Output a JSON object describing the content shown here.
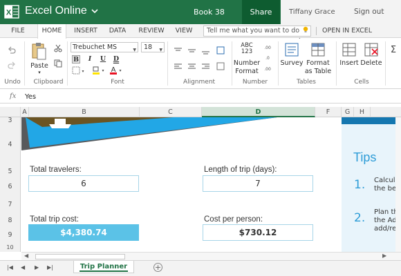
{
  "app": {
    "name": "Excel Online",
    "book_title": "Book 38",
    "share_label": "Share",
    "user_name": "Tiffany Grace Reyes",
    "signout_label": "Sign out"
  },
  "tabs": [
    {
      "label": "FILE"
    },
    {
      "label": "HOME"
    },
    {
      "label": "INSERT"
    },
    {
      "label": "DATA"
    },
    {
      "label": "REVIEW"
    },
    {
      "label": "VIEW"
    }
  ],
  "tellme": {
    "placeholder": "Tell me what you want to do"
  },
  "open_in_excel": "OPEN IN EXCEL",
  "ribbon": {
    "undo_group": "Undo",
    "clipboard_group": "Clipboard",
    "font_group": "Font",
    "alignment_group": "Alignment",
    "number_group": "Number",
    "tables_group": "Tables",
    "cells_group": "Cells",
    "paste_label": "Paste",
    "font_name": "Trebuchet MS",
    "font_size": "18",
    "bold": "B",
    "italic": "I",
    "underline": "U",
    "double_underline": "D",
    "number_format_line1": "Number",
    "number_format_line2": "Format",
    "number_format_icon": "ABC 123",
    "survey_label": "Survey",
    "format_table_line1": "Format",
    "format_table_line2": "as Table",
    "insert_label": "Insert",
    "delete_label": "Delete"
  },
  "formula_bar": {
    "fx": "fx",
    "value": "Yes"
  },
  "columns": [
    "A",
    "B",
    "C",
    "D",
    "F",
    "G",
    "H"
  ],
  "selected_column": "D",
  "rows": [
    "3",
    "4",
    "5",
    "6",
    "7",
    "8",
    "9",
    "10"
  ],
  "sheet": {
    "total_travelers_label": "Total travelers:",
    "total_travelers_value": "6",
    "length_of_trip_label": "Length of trip (days):",
    "length_of_trip_value": "7",
    "total_trip_cost_label": "Total trip cost:",
    "total_trip_cost_value": "$4,380.74",
    "cost_per_person_label": "Cost per person:",
    "cost_per_person_value": "$730.12"
  },
  "tips": {
    "title": "Tips",
    "items": [
      {
        "num": "1.",
        "line1": "Calcula",
        "line2": "the bes"
      },
      {
        "num": "2.",
        "line1": "Plan th",
        "line2": "the Ad",
        "line3": "add/re"
      }
    ]
  },
  "sheet_tabs": [
    {
      "label": "Trip Planner"
    }
  ],
  "colors": {
    "excel_green": "#217346",
    "dark_green": "#0e5c30",
    "accent_blue": "#5bc2e7",
    "tips_blue": "#2d9cd7"
  }
}
